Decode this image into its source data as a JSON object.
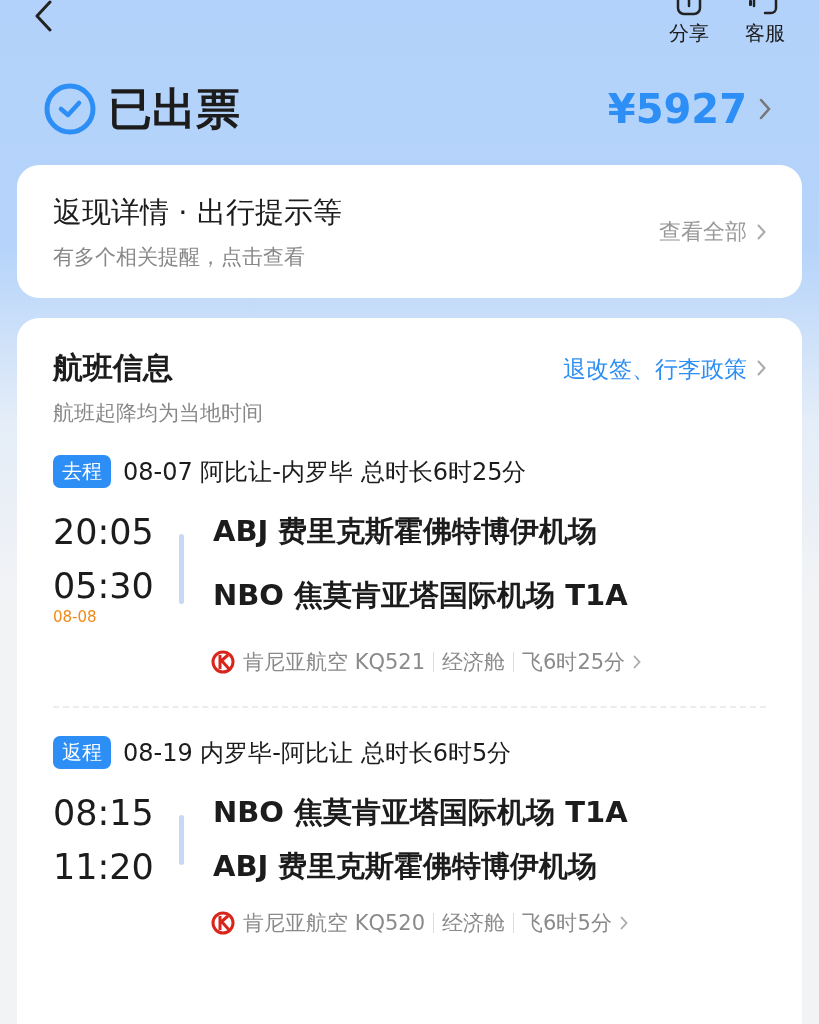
{
  "nav": {
    "share_label": "分享",
    "service_label": "客服"
  },
  "status": {
    "label": "已出票",
    "price": "¥5927"
  },
  "notice": {
    "title": "返现详情 · 出行提示等",
    "subtitle": "有多个相关提醒，点击查看",
    "action": "查看全部"
  },
  "flight_info": {
    "title": "航班信息",
    "subtitle": "航班起降均为当地时间",
    "policy_link": "退改签、行李政策",
    "segments": [
      {
        "tag": "去程",
        "summary": "08-07 阿比让-内罗毕 总时长6时25分",
        "depart_time": "20:05",
        "depart_airport": "ABJ 费里克斯霍佛特博伊机场",
        "arrive_time": "05:30",
        "arrive_date": "08-08",
        "arrive_airport": "NBO 焦莫肯亚塔国际机场 T1A",
        "airline": "肯尼亚航空 KQ521",
        "cabin": "经济舱",
        "duration": "飞6时25分"
      },
      {
        "tag": "返程",
        "summary": "08-19 内罗毕-阿比让 总时长6时5分",
        "depart_time": "08:15",
        "depart_airport": "NBO 焦莫肯亚塔国际机场 T1A",
        "arrive_time": "11:20",
        "arrive_airport": "ABJ 费里克斯霍佛特博伊机场",
        "airline": "肯尼亚航空 KQ520",
        "cabin": "经济舱",
        "duration": "飞6时5分"
      }
    ]
  }
}
